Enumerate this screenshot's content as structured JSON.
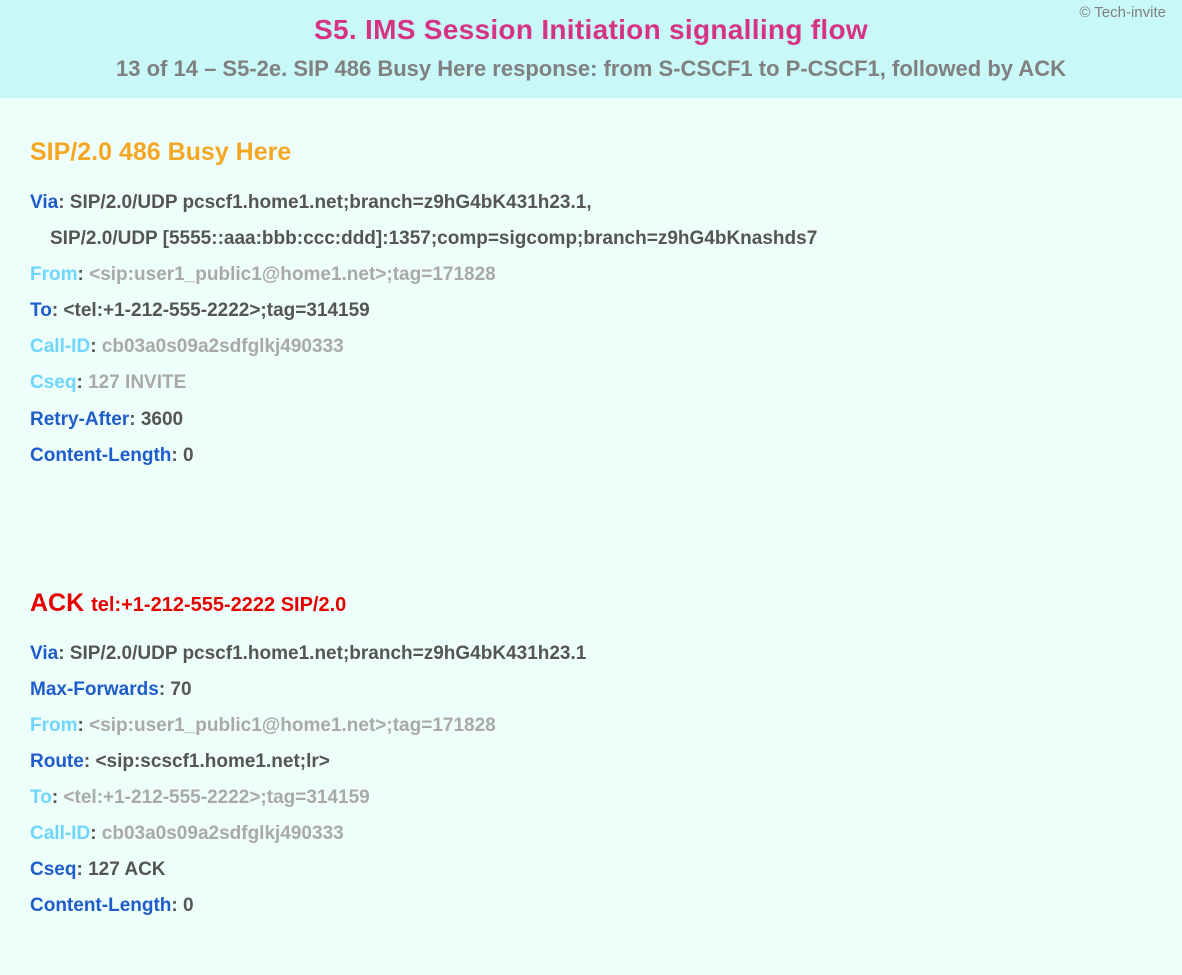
{
  "header": {
    "copyright": "© Tech-invite",
    "title": "S5. IMS Session Initiation signalling flow",
    "subtitle": "13 of 14 – S5-2e. SIP 486 Busy Here response: from S-CSCF1 to P-CSCF1, followed by ACK"
  },
  "msg1": {
    "title": "SIP/2.0 486 Busy Here",
    "via": {
      "label": "Via",
      "line1": "SIP/2.0/UDP pcscf1.home1.net;branch=z9hG4bK431h23.1,",
      "line2": "SIP/2.0/UDP [5555::aaa:bbb:ccc:ddd]:1357;comp=sigcomp;branch=z9hG4bKnashds7"
    },
    "from": {
      "label": "From",
      "value": "<sip:user1_public1@home1.net>;tag=171828"
    },
    "to": {
      "label": "To",
      "value": "<tel:+1-212-555-2222>;tag=314159"
    },
    "callid": {
      "label": "Call-ID",
      "value": "cb03a0s09a2sdfglkj490333"
    },
    "cseq": {
      "label": "Cseq",
      "value": "127 INVITE"
    },
    "retryafter": {
      "label": "Retry-After",
      "value": "3600"
    },
    "contentlength": {
      "label": "Content-Length",
      "value": "0"
    }
  },
  "msg2": {
    "title_method": "ACK",
    "title_tail": "tel:+1-212-555-2222 SIP/2.0",
    "via": {
      "label": "Via",
      "value": "SIP/2.0/UDP pcscf1.home1.net;branch=z9hG4bK431h23.1"
    },
    "maxforwards": {
      "label": "Max-Forwards",
      "value": "70"
    },
    "from": {
      "label": "From",
      "value": "<sip:user1_public1@home1.net>;tag=171828"
    },
    "route": {
      "label": "Route",
      "value": "<sip:scscf1.home1.net;lr>"
    },
    "to": {
      "label": "To",
      "value": "<tel:+1-212-555-2222>;tag=314159"
    },
    "callid": {
      "label": "Call-ID",
      "value": "cb03a0s09a2sdfglkj490333"
    },
    "cseq": {
      "label": "Cseq",
      "value": "127 ACK"
    },
    "contentlength": {
      "label": "Content-Length",
      "value": "0"
    }
  }
}
